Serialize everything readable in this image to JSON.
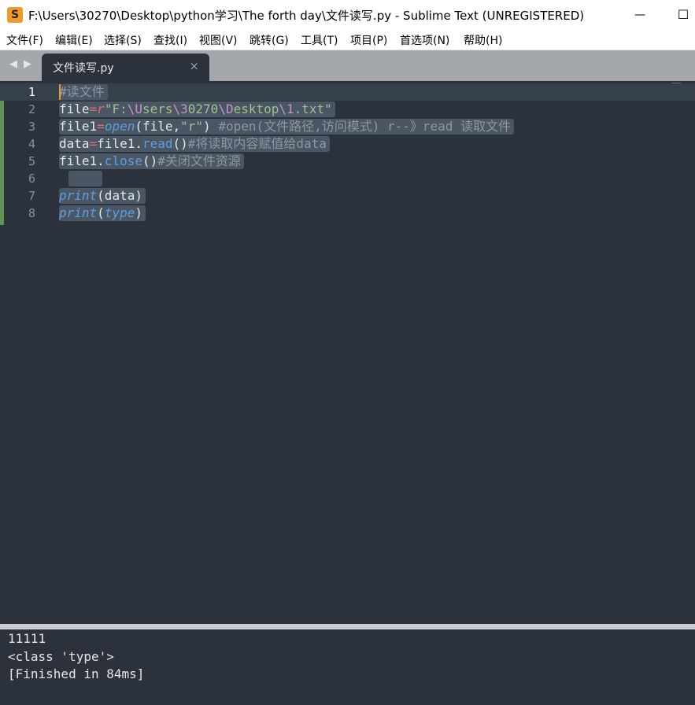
{
  "window": {
    "title": "F:\\Users\\30270\\Desktop\\python学习\\The forth day\\文件读写.py - Sublime Text (UNREGISTERED)",
    "app_icon": "S",
    "minimize_glyph": "—",
    "maximize_glyph": "☐"
  },
  "menu": [
    "文件(F)",
    "编辑(E)",
    "选择(S)",
    "查找(I)",
    "视图(V)",
    "跳转(G)",
    "工具(T)",
    "项目(P)",
    "首选项(N)",
    "帮助(H)"
  ],
  "tabs": {
    "nav_left": "◀",
    "nav_right": "▶",
    "active": {
      "label": "文件读写.py",
      "close": "×"
    }
  },
  "editor": {
    "line_numbers": [
      "1",
      "2",
      "3",
      "4",
      "5",
      "6",
      "7",
      "8"
    ],
    "line1": {
      "comment": "#读文件"
    },
    "line2": {
      "a": "file",
      "op": "=",
      "prefix": "r",
      "s1": "\"F:",
      "e1": "\\U",
      "s2": "sers",
      "e2": "\\3",
      "s3": "0270",
      "e3": "\\D",
      "s4": "esktop",
      "e4": "\\1",
      "s5": ".txt\""
    },
    "line3": {
      "a": "file1",
      "op": "=",
      "fn": "open",
      "b": "(file,",
      "s": "\"r\"",
      "c": ") ",
      "comment": "#open(文件路径,访问模式) r--》read 读取文件"
    },
    "line4": {
      "a": "data",
      "op": "=",
      "b": "file1.",
      "m": "read",
      "c": "()",
      "comment": "#将读取内容赋值给data"
    },
    "line5": {
      "a": "file1.",
      "m": "close",
      "c": "()",
      "comment": "#关闭文件资源"
    },
    "line6": {
      "indent": "    "
    },
    "line7": {
      "fn": "print",
      "b": "(data)"
    },
    "line8": {
      "fn": "print",
      "b": "(",
      "arg": "type",
      "c": ")"
    }
  },
  "output": {
    "lines": [
      "11111",
      "<class 'type'>",
      "[Finished in 84ms]"
    ]
  },
  "colors": {
    "editor_bg": "#2b323b",
    "selection": "#4a5664",
    "comment": "#8e96a0",
    "keyword": "#5d9fe0",
    "string": "#9dc28b",
    "operator": "#e06c75",
    "accent": "#f29b24"
  }
}
